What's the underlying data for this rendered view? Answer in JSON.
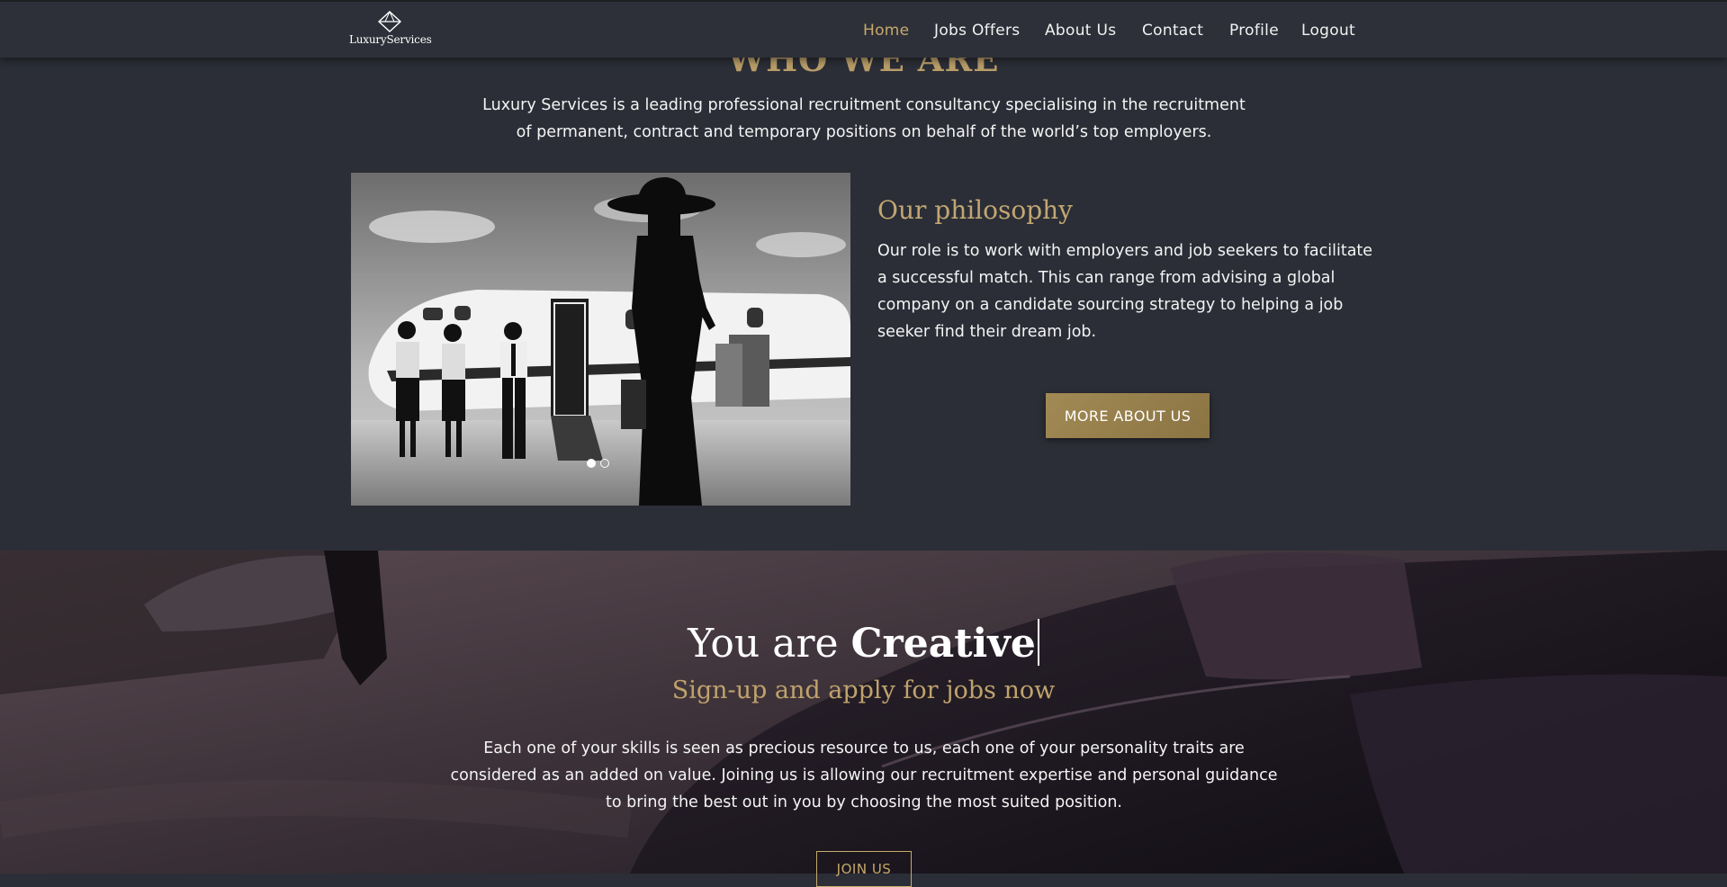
{
  "brand": {
    "name": "LuxuryServices"
  },
  "nav": {
    "items": [
      {
        "label": "Home",
        "active": true
      },
      {
        "label": "Jobs Offers"
      },
      {
        "label": "About Us"
      },
      {
        "label": "Contact"
      },
      {
        "label": "Profile"
      },
      {
        "label": "Logout"
      }
    ]
  },
  "about": {
    "title": "WHO WE ARE",
    "intro": "Luxury Services is a leading professional recruitment consultancy specialising in the recruitment of permanent, contract and temporary positions on behalf of the world’s top employers.",
    "philosophy_title": "Our philosophy",
    "philosophy_text": "Our role is to work with employers and job seekers to facilitate a successful match. This can range from advising a global company on a candidate sourcing strategy to helping a job seeker find their dream job.",
    "more_button": "MORE ABOUT US",
    "carousel": {
      "slides": 2,
      "active_index": 0
    }
  },
  "signup": {
    "prefix": "You are",
    "word": "Creative",
    "subtitle": "Sign-up and apply for jobs now",
    "text": "Each one of your skills is seen as precious resource to us, each one of your personality traits are considered as an added on value. Joining us is allowing our recruitment expertise and personal guidance to bring the best out in you by choosing the most suited position.",
    "join_button": "JOIN US"
  },
  "colors": {
    "accent": "#c6a96b",
    "background": "#2b2e36",
    "button_gold": "#9c8450"
  },
  "icons": {
    "logo": "diamond-logo-icon"
  }
}
